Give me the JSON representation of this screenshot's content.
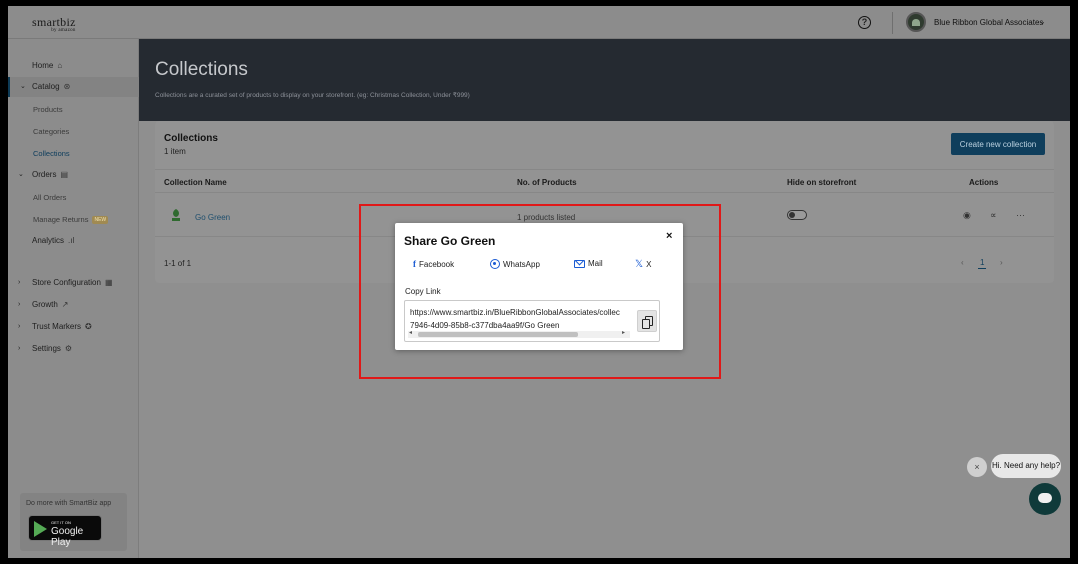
{
  "header": {
    "logo_text": "smartbiz",
    "logo_sub": "by amazon",
    "help_icon": "question-circle-icon",
    "account_name": "Blue Ribbon Global Associates"
  },
  "sidebar": {
    "items": [
      {
        "label": "Home"
      },
      {
        "label": "Catalog"
      },
      {
        "label": "Products"
      },
      {
        "label": "Categories"
      },
      {
        "label": "Collections"
      },
      {
        "label": "Orders"
      },
      {
        "label": "All Orders"
      },
      {
        "label": "Manage Returns"
      },
      {
        "label": "Analytics"
      },
      {
        "label": "Store Configuration"
      },
      {
        "label": "Growth"
      },
      {
        "label": "Trust Markers"
      },
      {
        "label": "Settings"
      }
    ],
    "new_badge": "NEW",
    "app_promo": "Do more with SmartBiz app",
    "gplay_small": "GET IT ON",
    "gplay_big": "Google Play"
  },
  "page": {
    "title": "Collections",
    "subtitle": "Collections are a curated set of products to display on your storefront. (eg: Christmas Collection, Under ₹999)"
  },
  "card": {
    "title": "Collections",
    "count": "1 item",
    "create_label": "Create new collection",
    "columns": [
      "Collection Name",
      "No. of Products",
      "Hide on storefront",
      "Actions"
    ],
    "rows": [
      {
        "name": "Go Green",
        "products": "1 products listed",
        "hidden": false
      }
    ],
    "range": "1-1 of 1",
    "current_page": "1"
  },
  "modal": {
    "title": "Share Go Green",
    "close": "×",
    "share_options": [
      "Facebook",
      "WhatsApp",
      "Mail",
      "X"
    ],
    "copy_label": "Copy Link",
    "link_line1": "https://www.smartbiz.in/BlueRibbonGlobalAssociates/collec",
    "link_line2": "7946-4d09-85b8-c377dba4aa9f/Go Green"
  },
  "chat": {
    "close": "×",
    "bubble": "Hi. Need any help?"
  },
  "colors": {
    "accent": "#0f3e5c",
    "highlight": "#e01818",
    "header_bg": "#252a31",
    "share_icon": "#1a5bd3"
  }
}
